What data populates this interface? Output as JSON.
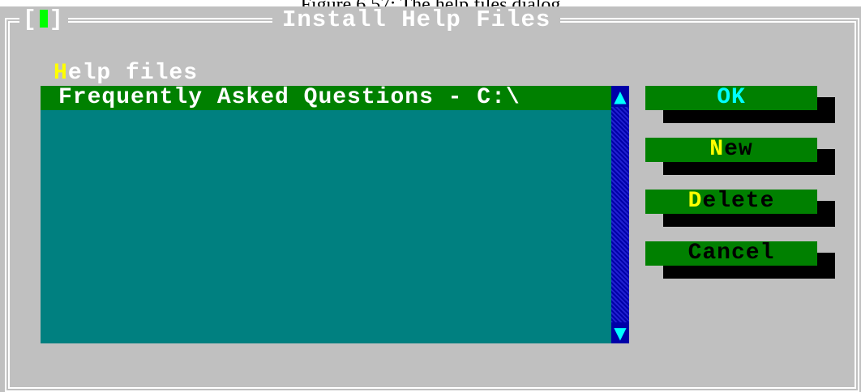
{
  "caption": "Figure 6.57: The help files dialog",
  "dialog": {
    "title": "Install Help Files",
    "close_box_left": "[",
    "close_box_right": "]"
  },
  "list": {
    "label_hotkey": "H",
    "label_rest": "elp files",
    "items": [
      {
        "text": "Frequently Asked Questions - C:\\"
      }
    ],
    "scroll_up_glyph": "▲",
    "scroll_down_glyph": "▼"
  },
  "buttons": {
    "ok": {
      "label": "OK"
    },
    "new": {
      "hotkey": "N",
      "rest": "ew"
    },
    "delete": {
      "hotkey": "D",
      "rest": "elete"
    },
    "cancel": {
      "label": "Cancel"
    }
  },
  "colors": {
    "dialog_bg": "#c0c0c0",
    "list_bg": "#008080",
    "selected_bg": "#008000",
    "button_bg": "#008000",
    "hotkey": "#ffff00",
    "scrollbar": "#0000a8"
  }
}
